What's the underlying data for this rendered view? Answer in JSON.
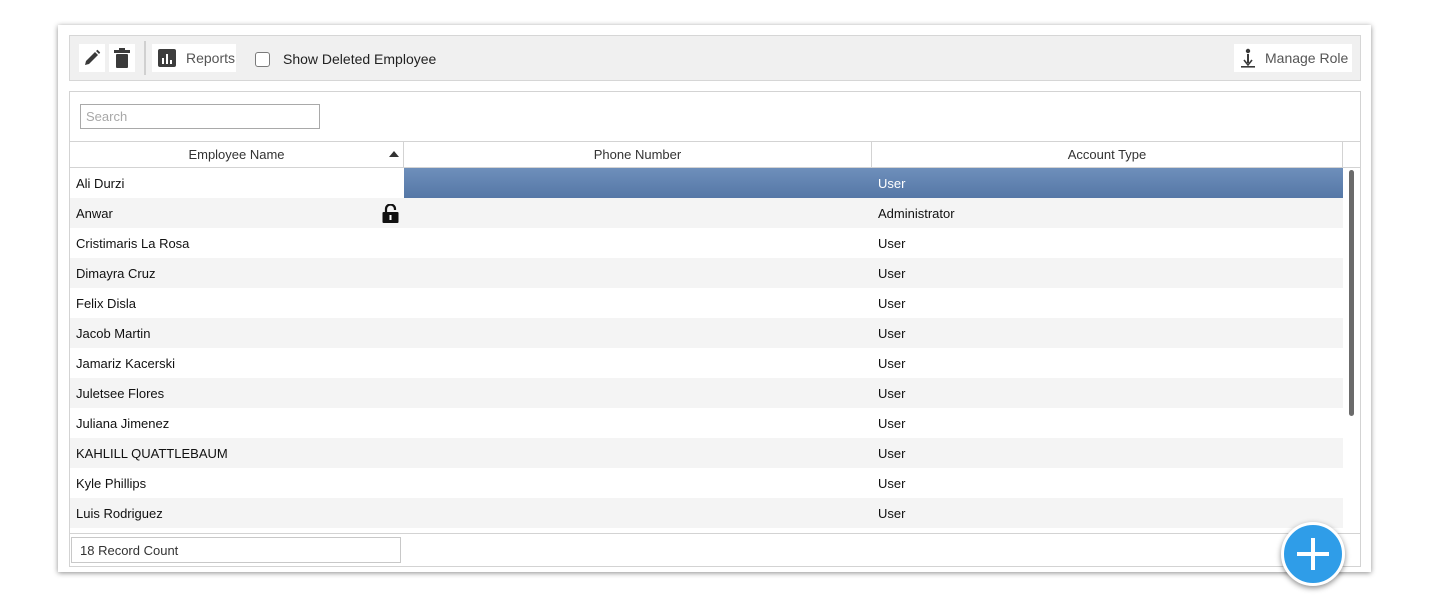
{
  "toolbar": {
    "edit_icon": "pencil-icon",
    "delete_icon": "trash-icon",
    "reports_label": "Reports",
    "reports_icon": "bar-chart-icon",
    "show_deleted_label": "Show Deleted Employee",
    "show_deleted_checked": false,
    "manage_role_label": "Manage Role",
    "manage_role_icon": "person-arrow-icon"
  },
  "search": {
    "placeholder": "Search",
    "value": ""
  },
  "grid": {
    "columns": [
      {
        "label": "Employee Name",
        "sort": "ascending"
      },
      {
        "label": "Phone Number"
      },
      {
        "label": "Account Type"
      }
    ],
    "rows": [
      {
        "name": "Ali Durzi",
        "phone": "",
        "type": "User",
        "selected": true
      },
      {
        "name": "Anwar",
        "phone": "",
        "type": "Administrator",
        "locked": true
      },
      {
        "name": "Cristimaris La Rosa",
        "phone": "",
        "type": "User"
      },
      {
        "name": "Dimayra Cruz",
        "phone": "",
        "type": "User"
      },
      {
        "name": "Felix Disla",
        "phone": "",
        "type": "User"
      },
      {
        "name": "Jacob Martin",
        "phone": "",
        "type": "User"
      },
      {
        "name": "Jamariz Kacerski",
        "phone": "",
        "type": "User"
      },
      {
        "name": "Juletsee Flores",
        "phone": "",
        "type": "User"
      },
      {
        "name": "Juliana Jimenez",
        "phone": "",
        "type": "User"
      },
      {
        "name": "KAHLILL QUATTLEBAUM",
        "phone": "",
        "type": "User"
      },
      {
        "name": "Kyle Phillips",
        "phone": "",
        "type": "User"
      },
      {
        "name": "Luis Rodriguez",
        "phone": "",
        "type": "User"
      }
    ],
    "record_count": "18 Record Count"
  },
  "fab": {
    "icon": "plus-icon"
  },
  "colors": {
    "selection": "#6080ad",
    "fab": "#2f9de8",
    "toolbar_bg": "#f0f0f0"
  }
}
